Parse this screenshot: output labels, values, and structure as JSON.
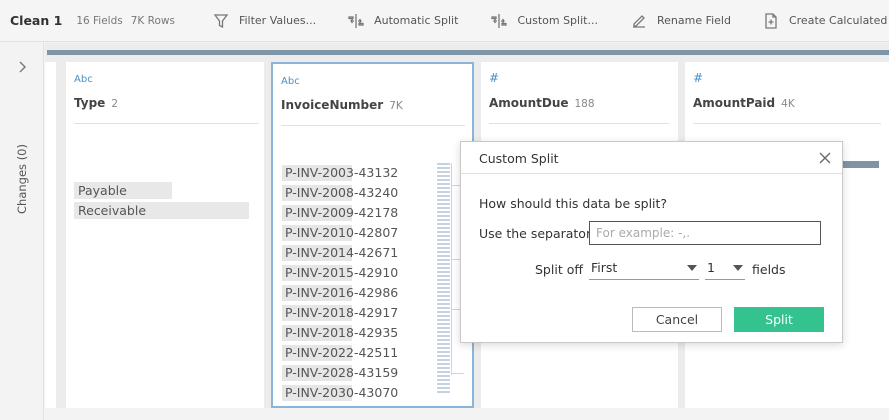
{
  "toolbar": {
    "title": "Clean 1",
    "fields": "16 Fields",
    "rows": "7K Rows",
    "buttons": [
      {
        "label": "Filter Values...",
        "icon": "filter-icon"
      },
      {
        "label": "Automatic Split",
        "icon": "split-icon"
      },
      {
        "label": "Custom Split...",
        "icon": "custom-split-icon"
      },
      {
        "label": "Rename Field",
        "icon": "rename-icon"
      },
      {
        "label": "Create Calculated Field...",
        "icon": "calculated-field-icon"
      }
    ]
  },
  "rail": {
    "label": "Changes (0)"
  },
  "columns": [
    {
      "type_glyph": "Abc",
      "name": "Type",
      "count": "2",
      "values": [
        "Payable",
        "Receivable"
      ],
      "value_fill": [
        0.5,
        1.0
      ]
    },
    {
      "type_glyph": "Abc",
      "name": "InvoiceNumber",
      "count": "7K",
      "values": [
        "P-INV-2003-43132",
        "P-INV-2008-43240",
        "P-INV-2009-42178",
        "P-INV-2010-42807",
        "P-INV-2014-42671",
        "P-INV-2015-42910",
        "P-INV-2016-42986",
        "P-INV-2018-42917",
        "P-INV-2018-42935",
        "P-INV-2022-42511",
        "P-INV-2028-43159",
        "P-INV-2030-43070"
      ]
    },
    {
      "type_glyph": "#",
      "name": "AmountDue",
      "count": "188"
    },
    {
      "type_glyph": "#",
      "name": "AmountPaid",
      "count": "4K"
    }
  ],
  "dialog": {
    "title": "Custom Split",
    "question": "How should this data be split?",
    "separator_label": "Use the separator",
    "separator_value": "",
    "separator_placeholder": "For example: -,.",
    "splitoff_label": "Split off",
    "splitoff_value": "First",
    "count_value": "1",
    "fields_label": "fields",
    "cancel_label": "Cancel",
    "split_label": "Split"
  },
  "colors": {
    "accent_green": "#34c28f",
    "selected_border": "#8ab4d8",
    "header_bar": "#7e95a8",
    "type_glyph": "#4a90c6"
  }
}
